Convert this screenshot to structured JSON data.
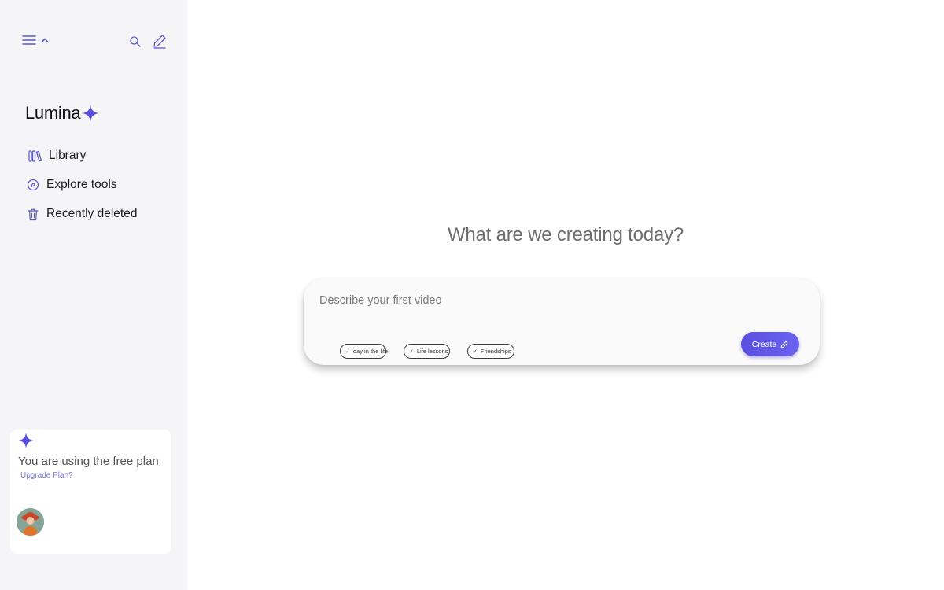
{
  "sidebar": {
    "brand": "Lumina",
    "nav": [
      {
        "label": "Library",
        "icon": "library-icon"
      },
      {
        "label": "Explore tools",
        "icon": "compass-icon"
      },
      {
        "label": "Recently deleted",
        "icon": "trash-icon"
      }
    ],
    "plan": {
      "title": "You are using the free plan",
      "upgrade_label": "Upgrade Plan?"
    }
  },
  "main": {
    "heading": "What are we creating today?",
    "prompt": {
      "placeholder": "Describe your first video",
      "value": ""
    },
    "chips": [
      {
        "label": "day in the life"
      },
      {
        "label": "Life lessons"
      },
      {
        "label": "Friendships"
      }
    ],
    "create_label": "Create"
  },
  "colors": {
    "accent": "#5a4fe0",
    "sidebar_bg": "#f5f5f7",
    "icon": "#5a56c8"
  }
}
